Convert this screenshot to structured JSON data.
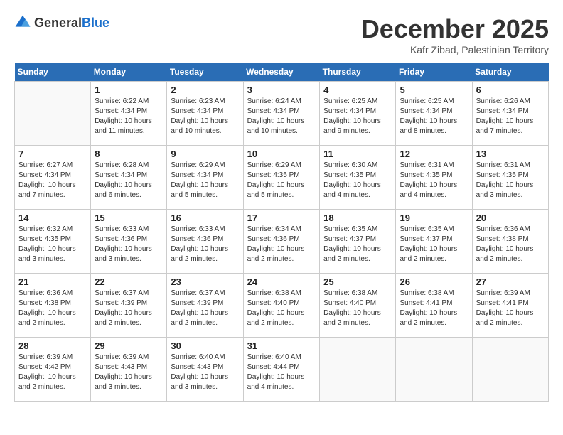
{
  "logo": {
    "general": "General",
    "blue": "Blue"
  },
  "title": "December 2025",
  "location": "Kafr Zibad, Palestinian Territory",
  "days_of_week": [
    "Sunday",
    "Monday",
    "Tuesday",
    "Wednesday",
    "Thursday",
    "Friday",
    "Saturday"
  ],
  "weeks": [
    [
      {
        "day": "",
        "info": ""
      },
      {
        "day": "1",
        "info": "Sunrise: 6:22 AM\nSunset: 4:34 PM\nDaylight: 10 hours and 11 minutes."
      },
      {
        "day": "2",
        "info": "Sunrise: 6:23 AM\nSunset: 4:34 PM\nDaylight: 10 hours and 10 minutes."
      },
      {
        "day": "3",
        "info": "Sunrise: 6:24 AM\nSunset: 4:34 PM\nDaylight: 10 hours and 10 minutes."
      },
      {
        "day": "4",
        "info": "Sunrise: 6:25 AM\nSunset: 4:34 PM\nDaylight: 10 hours and 9 minutes."
      },
      {
        "day": "5",
        "info": "Sunrise: 6:25 AM\nSunset: 4:34 PM\nDaylight: 10 hours and 8 minutes."
      },
      {
        "day": "6",
        "info": "Sunrise: 6:26 AM\nSunset: 4:34 PM\nDaylight: 10 hours and 7 minutes."
      }
    ],
    [
      {
        "day": "7",
        "info": "Sunrise: 6:27 AM\nSunset: 4:34 PM\nDaylight: 10 hours and 7 minutes."
      },
      {
        "day": "8",
        "info": "Sunrise: 6:28 AM\nSunset: 4:34 PM\nDaylight: 10 hours and 6 minutes."
      },
      {
        "day": "9",
        "info": "Sunrise: 6:29 AM\nSunset: 4:34 PM\nDaylight: 10 hours and 5 minutes."
      },
      {
        "day": "10",
        "info": "Sunrise: 6:29 AM\nSunset: 4:35 PM\nDaylight: 10 hours and 5 minutes."
      },
      {
        "day": "11",
        "info": "Sunrise: 6:30 AM\nSunset: 4:35 PM\nDaylight: 10 hours and 4 minutes."
      },
      {
        "day": "12",
        "info": "Sunrise: 6:31 AM\nSunset: 4:35 PM\nDaylight: 10 hours and 4 minutes."
      },
      {
        "day": "13",
        "info": "Sunrise: 6:31 AM\nSunset: 4:35 PM\nDaylight: 10 hours and 3 minutes."
      }
    ],
    [
      {
        "day": "14",
        "info": "Sunrise: 6:32 AM\nSunset: 4:35 PM\nDaylight: 10 hours and 3 minutes."
      },
      {
        "day": "15",
        "info": "Sunrise: 6:33 AM\nSunset: 4:36 PM\nDaylight: 10 hours and 3 minutes."
      },
      {
        "day": "16",
        "info": "Sunrise: 6:33 AM\nSunset: 4:36 PM\nDaylight: 10 hours and 2 minutes."
      },
      {
        "day": "17",
        "info": "Sunrise: 6:34 AM\nSunset: 4:36 PM\nDaylight: 10 hours and 2 minutes."
      },
      {
        "day": "18",
        "info": "Sunrise: 6:35 AM\nSunset: 4:37 PM\nDaylight: 10 hours and 2 minutes."
      },
      {
        "day": "19",
        "info": "Sunrise: 6:35 AM\nSunset: 4:37 PM\nDaylight: 10 hours and 2 minutes."
      },
      {
        "day": "20",
        "info": "Sunrise: 6:36 AM\nSunset: 4:38 PM\nDaylight: 10 hours and 2 minutes."
      }
    ],
    [
      {
        "day": "21",
        "info": "Sunrise: 6:36 AM\nSunset: 4:38 PM\nDaylight: 10 hours and 2 minutes."
      },
      {
        "day": "22",
        "info": "Sunrise: 6:37 AM\nSunset: 4:39 PM\nDaylight: 10 hours and 2 minutes."
      },
      {
        "day": "23",
        "info": "Sunrise: 6:37 AM\nSunset: 4:39 PM\nDaylight: 10 hours and 2 minutes."
      },
      {
        "day": "24",
        "info": "Sunrise: 6:38 AM\nSunset: 4:40 PM\nDaylight: 10 hours and 2 minutes."
      },
      {
        "day": "25",
        "info": "Sunrise: 6:38 AM\nSunset: 4:40 PM\nDaylight: 10 hours and 2 minutes."
      },
      {
        "day": "26",
        "info": "Sunrise: 6:38 AM\nSunset: 4:41 PM\nDaylight: 10 hours and 2 minutes."
      },
      {
        "day": "27",
        "info": "Sunrise: 6:39 AM\nSunset: 4:41 PM\nDaylight: 10 hours and 2 minutes."
      }
    ],
    [
      {
        "day": "28",
        "info": "Sunrise: 6:39 AM\nSunset: 4:42 PM\nDaylight: 10 hours and 2 minutes."
      },
      {
        "day": "29",
        "info": "Sunrise: 6:39 AM\nSunset: 4:43 PM\nDaylight: 10 hours and 3 minutes."
      },
      {
        "day": "30",
        "info": "Sunrise: 6:40 AM\nSunset: 4:43 PM\nDaylight: 10 hours and 3 minutes."
      },
      {
        "day": "31",
        "info": "Sunrise: 6:40 AM\nSunset: 4:44 PM\nDaylight: 10 hours and 4 minutes."
      },
      {
        "day": "",
        "info": ""
      },
      {
        "day": "",
        "info": ""
      },
      {
        "day": "",
        "info": ""
      }
    ]
  ]
}
